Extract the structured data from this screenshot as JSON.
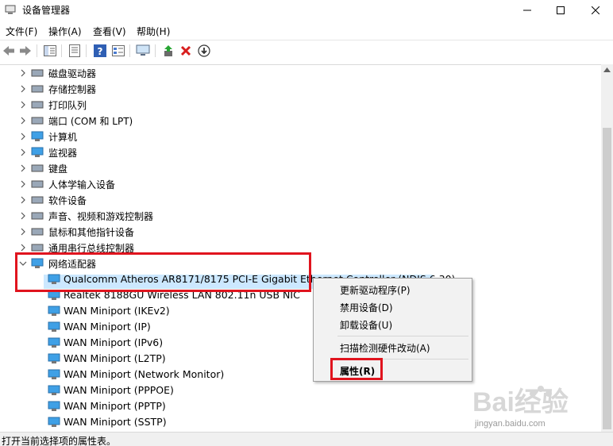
{
  "window": {
    "title": "设备管理器"
  },
  "menu": [
    "文件(F)",
    "操作(A)",
    "查看(V)",
    "帮助(H)"
  ],
  "toolbar": {
    "icons": [
      "back-icon",
      "forward-icon",
      "show-hide-tree-icon",
      "properties-icon",
      "help-icon",
      "view-icon",
      "monitor-icon",
      "update-driver-icon",
      "uninstall-icon",
      "disable-icon"
    ],
    "colors": {
      "uninstall": "#d81e1e",
      "help": "#2f5fb4"
    }
  },
  "tree": {
    "categories": [
      {
        "label": "磁盘驱动器",
        "icon": "disk-drive-icon"
      },
      {
        "label": "存储控制器",
        "icon": "storage-controller-icon"
      },
      {
        "label": "打印队列",
        "icon": "printer-icon"
      },
      {
        "label": "端口 (COM 和 LPT)",
        "icon": "port-icon"
      },
      {
        "label": "计算机",
        "icon": "computer-icon"
      },
      {
        "label": "监视器",
        "icon": "monitor-icon"
      },
      {
        "label": "键盘",
        "icon": "keyboard-icon"
      },
      {
        "label": "人体学输入设备",
        "icon": "hid-icon"
      },
      {
        "label": "软件设备",
        "icon": "software-device-icon"
      },
      {
        "label": "声音、视频和游戏控制器",
        "icon": "sound-icon"
      },
      {
        "label": "鼠标和其他指针设备",
        "icon": "mouse-icon"
      },
      {
        "label": "通用串行总线控制器",
        "icon": "usb-icon"
      }
    ],
    "expanded": {
      "label": "网络适配器",
      "icon": "network-adapter-icon",
      "children": [
        "Qualcomm Atheros AR8171/8175 PCI-E Gigabit Ethernet Controller (NDIS 6.30)",
        "Realtek 8188GU Wireless LAN 802.11n USB NIC",
        "WAN Miniport (IKEv2)",
        "WAN Miniport (IP)",
        "WAN Miniport (IPv6)",
        "WAN Miniport (L2TP)",
        "WAN Miniport (Network Monitor)",
        "WAN Miniport (PPPOE)",
        "WAN Miniport (PPTP)",
        "WAN Miniport (SSTP)"
      ]
    }
  },
  "context_menu": {
    "items": [
      "更新驱动程序(P)",
      "禁用设备(D)",
      "卸载设备(U)",
      "扫描检测硬件改动(A)",
      "属性(R)"
    ]
  },
  "status": "打开当前选择项的属性表。",
  "watermark": {
    "brand": "Bai经验",
    "url": "jingyan.baidu.com"
  },
  "highlight_color": "#e0141e"
}
